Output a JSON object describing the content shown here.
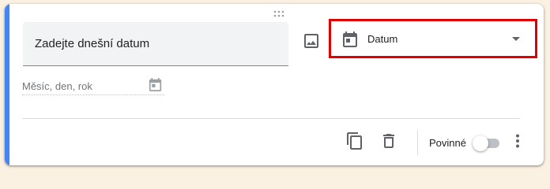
{
  "question": {
    "title": "Zadejte dnešní datum"
  },
  "type_select": {
    "icon": "calendar-icon",
    "label": "Datum"
  },
  "answer": {
    "placeholder": "Měsíc, den, rok",
    "icon": "calendar-icon"
  },
  "footer": {
    "required_label": "Povinné",
    "required_on": false,
    "icons": [
      "copy-icon",
      "trash-icon",
      "more-vert-icon"
    ]
  },
  "colors": {
    "accent": "#4285f4",
    "highlight": "#e00000",
    "background": "#faf1e3"
  }
}
